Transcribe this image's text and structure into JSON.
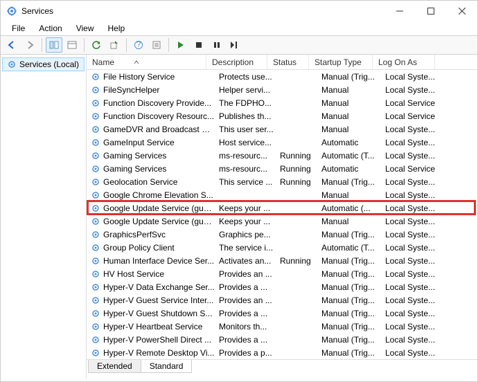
{
  "window": {
    "title": "Services"
  },
  "menu": [
    "File",
    "Action",
    "View",
    "Help"
  ],
  "tree": {
    "root": "Services (Local)"
  },
  "columns": {
    "name": "Name",
    "desc": "Description",
    "status": "Status",
    "start": "Startup Type",
    "log": "Log On As"
  },
  "tabs": {
    "extended": "Extended",
    "standard": "Standard"
  },
  "highlight_index": 10,
  "services": [
    {
      "name": "File History Service",
      "desc": "Protects use...",
      "status": "",
      "start": "Manual (Trig...",
      "log": "Local Syste..."
    },
    {
      "name": "FileSyncHelper",
      "desc": "Helper servi...",
      "status": "",
      "start": "Manual",
      "log": "Local Syste..."
    },
    {
      "name": "Function Discovery Provide...",
      "desc": "The FDPHO...",
      "status": "",
      "start": "Manual",
      "log": "Local Service"
    },
    {
      "name": "Function Discovery Resourc...",
      "desc": "Publishes th...",
      "status": "",
      "start": "Manual",
      "log": "Local Service"
    },
    {
      "name": "GameDVR and Broadcast Us...",
      "desc": "This user ser...",
      "status": "",
      "start": "Manual",
      "log": "Local Syste..."
    },
    {
      "name": "GameInput Service",
      "desc": "Host service...",
      "status": "",
      "start": "Automatic",
      "log": "Local Syste..."
    },
    {
      "name": "Gaming Services",
      "desc": "ms-resourc...",
      "status": "Running",
      "start": "Automatic (T...",
      "log": "Local Syste..."
    },
    {
      "name": "Gaming Services",
      "desc": "ms-resourc...",
      "status": "Running",
      "start": "Automatic",
      "log": "Local Service"
    },
    {
      "name": "Geolocation Service",
      "desc": "This service ...",
      "status": "Running",
      "start": "Manual (Trig...",
      "log": "Local Syste..."
    },
    {
      "name": "Google Chrome Elevation S...",
      "desc": "",
      "status": "",
      "start": "Manual",
      "log": "Local Syste..."
    },
    {
      "name": "Google Update Service (gup...",
      "desc": "Keeps your ...",
      "status": "",
      "start": "Automatic (...",
      "log": "Local Syste..."
    },
    {
      "name": "Google Update Service (gup...",
      "desc": "Keeps your ...",
      "status": "",
      "start": "Manual",
      "log": "Local Syste..."
    },
    {
      "name": "GraphicsPerfSvc",
      "desc": "Graphics pe...",
      "status": "",
      "start": "Manual (Trig...",
      "log": "Local Syste..."
    },
    {
      "name": "Group Policy Client",
      "desc": "The service i...",
      "status": "",
      "start": "Automatic (T...",
      "log": "Local Syste..."
    },
    {
      "name": "Human Interface Device Ser...",
      "desc": "Activates an...",
      "status": "Running",
      "start": "Manual (Trig...",
      "log": "Local Syste..."
    },
    {
      "name": "HV Host Service",
      "desc": "Provides an ...",
      "status": "",
      "start": "Manual (Trig...",
      "log": "Local Syste..."
    },
    {
      "name": "Hyper-V Data Exchange Ser...",
      "desc": "Provides a ...",
      "status": "",
      "start": "Manual (Trig...",
      "log": "Local Syste..."
    },
    {
      "name": "Hyper-V Guest Service Inter...",
      "desc": "Provides an ...",
      "status": "",
      "start": "Manual (Trig...",
      "log": "Local Syste..."
    },
    {
      "name": "Hyper-V Guest Shutdown S...",
      "desc": "Provides a ...",
      "status": "",
      "start": "Manual (Trig...",
      "log": "Local Syste..."
    },
    {
      "name": "Hyper-V Heartbeat Service",
      "desc": "Monitors th...",
      "status": "",
      "start": "Manual (Trig...",
      "log": "Local Syste..."
    },
    {
      "name": "Hyper-V PowerShell Direct ...",
      "desc": "Provides a ...",
      "status": "",
      "start": "Manual (Trig...",
      "log": "Local Syste..."
    },
    {
      "name": "Hyper-V Remote Desktop Vi...",
      "desc": "Provides a p...",
      "status": "",
      "start": "Manual (Trig...",
      "log": "Local Syste..."
    }
  ]
}
